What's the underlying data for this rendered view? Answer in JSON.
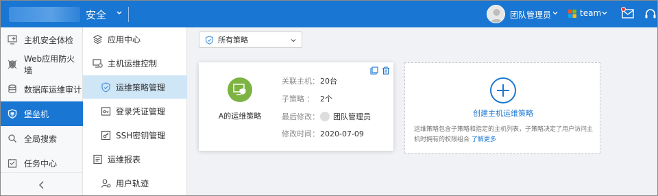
{
  "header": {
    "brand_suffix": "安全",
    "user_name": "团队管理员",
    "team_name": "team",
    "brand_color": "#1976d2"
  },
  "sidebar": {
    "items": [
      {
        "label": "主机安全体检",
        "icon": "host-check-icon"
      },
      {
        "label": "Web应用防火墙",
        "icon": "waf-icon"
      },
      {
        "label": "数据库运维审计",
        "icon": "database-icon"
      },
      {
        "label": "堡垒机",
        "icon": "bastion-shield-icon",
        "active": true
      },
      {
        "label": "全局搜索",
        "icon": "search-icon"
      },
      {
        "label": "任务中心",
        "icon": "task-icon"
      }
    ]
  },
  "subnav": {
    "items": [
      {
        "label": "应用中心",
        "icon": "app-center-icon",
        "level": 1
      },
      {
        "label": "主机运维控制",
        "icon": "host-ops-icon",
        "level": 1
      },
      {
        "label": "运维策略管理",
        "icon": "policy-shield-icon",
        "level": 2,
        "active": true
      },
      {
        "label": "登录凭证管理",
        "icon": "credential-icon",
        "level": 2
      },
      {
        "label": "SSH密钥管理",
        "icon": "ssh-key-icon",
        "level": 2
      },
      {
        "label": "运维报表",
        "icon": "report-icon",
        "level": 1
      },
      {
        "label": "用户轨迹",
        "icon": "user-track-icon",
        "level": 2
      }
    ]
  },
  "main": {
    "filter": {
      "selected": "所有策略"
    },
    "policy_card": {
      "name": "A的运维策略",
      "rows": [
        {
          "label": "关联主机：",
          "value": "20台"
        },
        {
          "label": "子策略 ：",
          "value": "2个"
        },
        {
          "label": "最后修改：",
          "value": "团队管理员"
        },
        {
          "label": "修改时间：",
          "value": "2020-07-09"
        }
      ],
      "icon_color": "#7cb342"
    },
    "create_card": {
      "label": "创建主机运维策略",
      "description": "运维策略包含子策略和指定的主机列表，子策略决定了用户访问主机时拥有的权限组合",
      "link": "了解更多"
    }
  }
}
